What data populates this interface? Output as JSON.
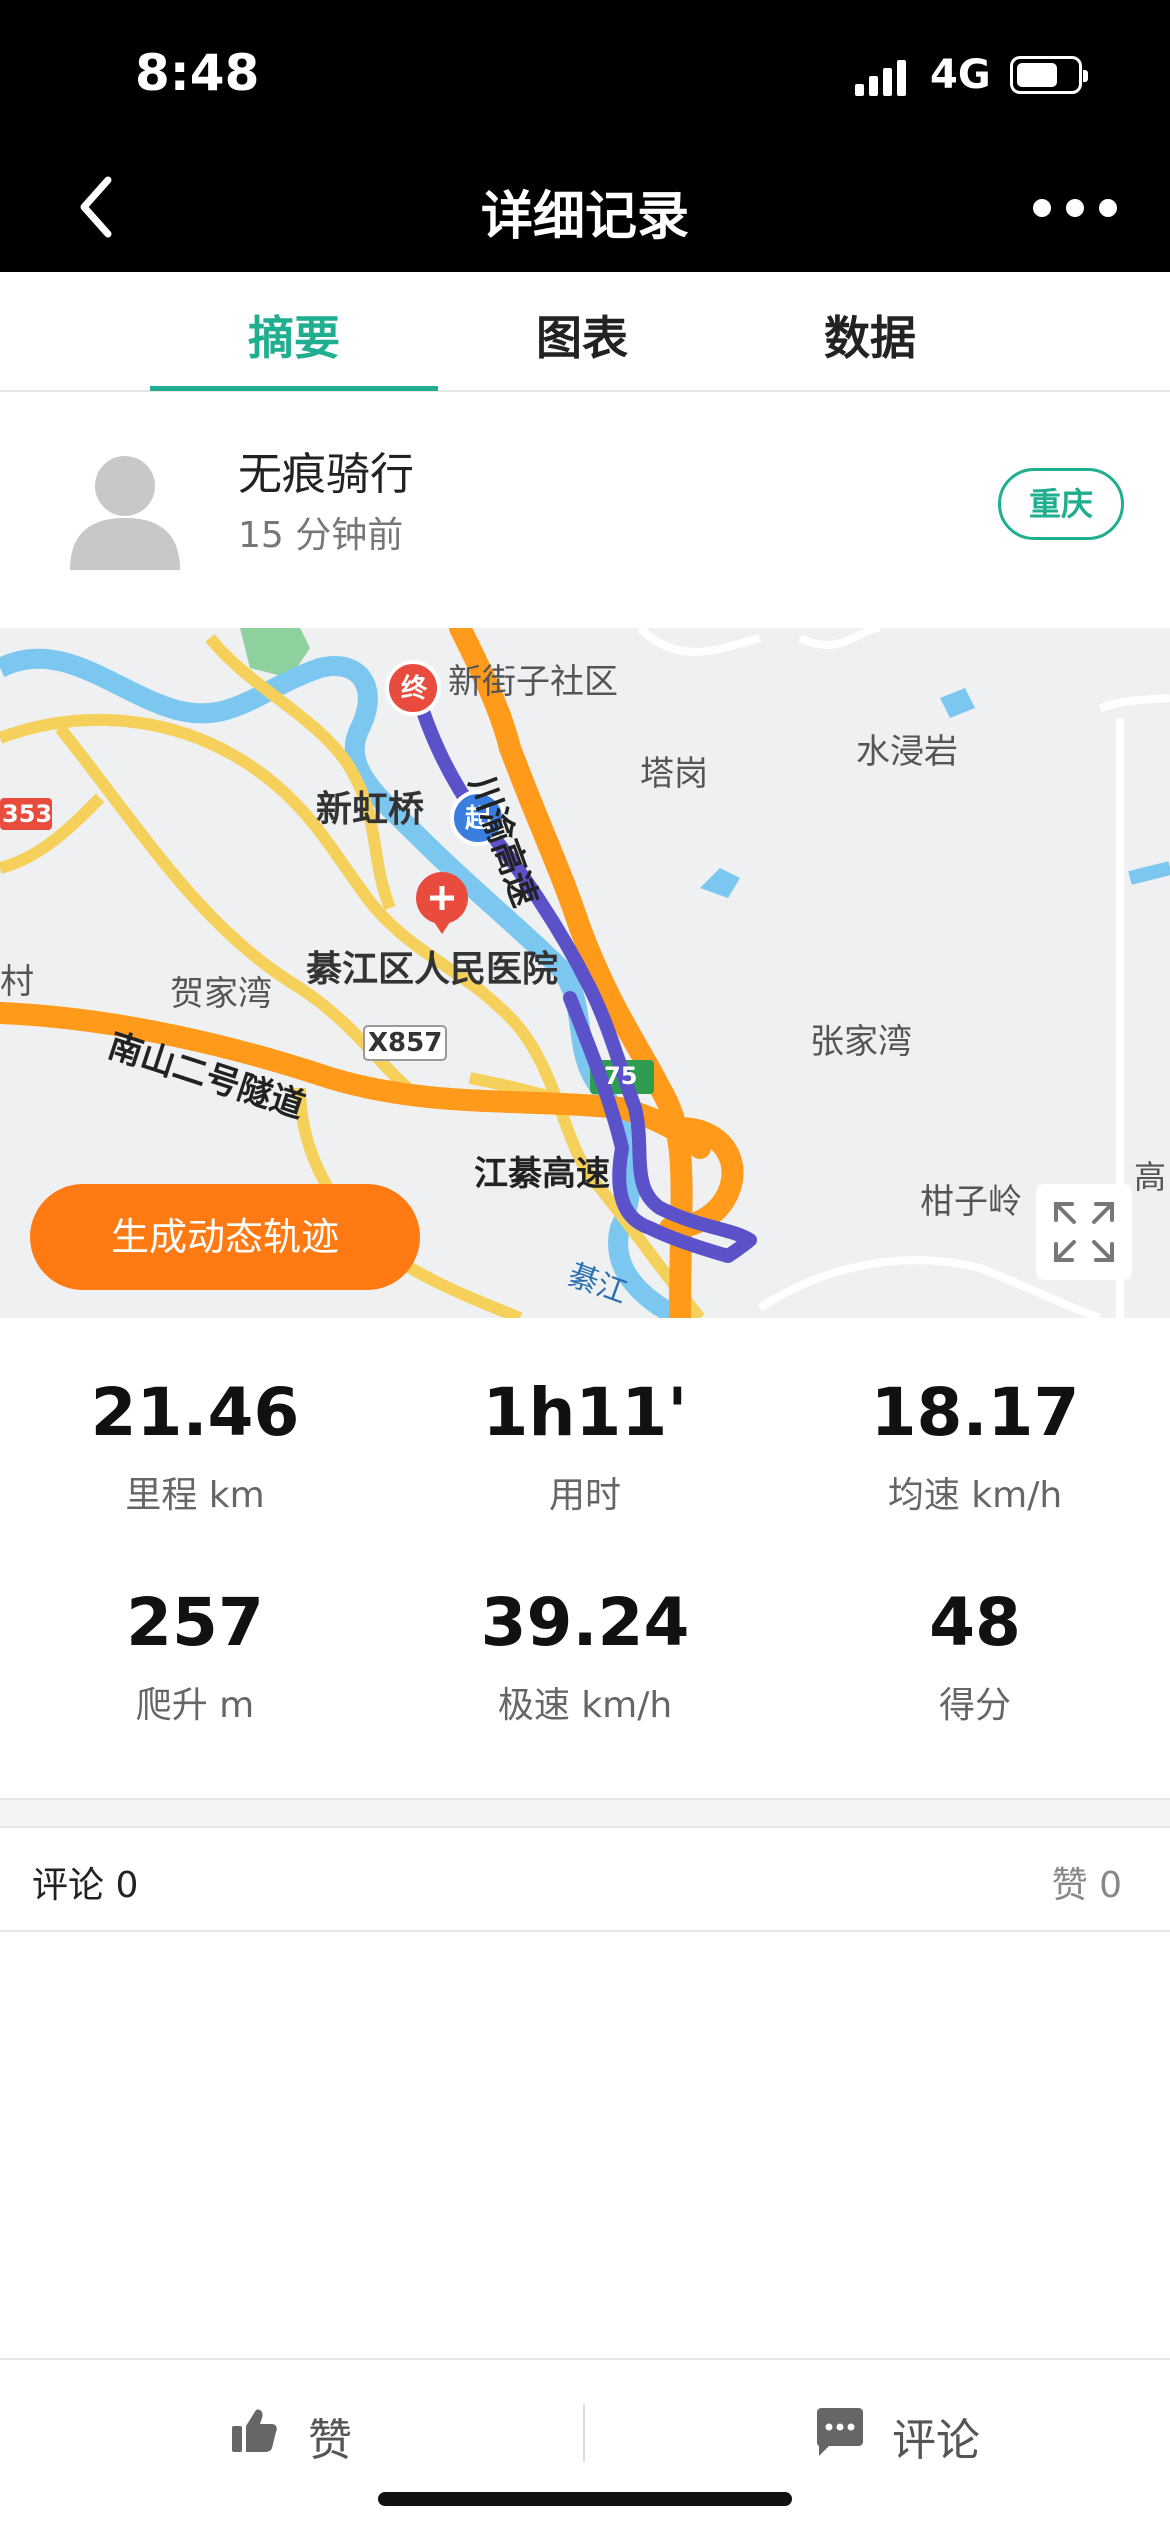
{
  "status_bar": {
    "time": "8:48",
    "network": "4G"
  },
  "nav": {
    "title": "详细记录"
  },
  "tabs": [
    {
      "label": "摘要"
    },
    {
      "label": "图表"
    },
    {
      "label": "数据"
    }
  ],
  "user": {
    "name": "无痕骑行",
    "time_ago": "15 分钟前",
    "city": "重庆"
  },
  "map": {
    "labels": {
      "l1": "新街子社区",
      "l2": "塔岗",
      "l3": "水浸岩",
      "l4": "新虹桥",
      "l5": "綦江区人民医院",
      "l6": "贺家湾",
      "l7": "X857",
      "l8": "南山二号隧道",
      "l9": "江綦高速",
      "l10": "张家湾",
      "l11": "柑子岭",
      "l12": "川渝高速",
      "l13": "綦江",
      "l14": "353",
      "l15": "村",
      "l16": "高",
      "l17": "75"
    },
    "end_marker": "终",
    "start_marker": "起",
    "generate_button": "生成动态轨迹"
  },
  "stats": [
    {
      "value": "21.46",
      "label": "里程 km"
    },
    {
      "value": "1h11'",
      "label": "用时"
    },
    {
      "value": "18.17",
      "label": "均速 km/h"
    },
    {
      "value": "257",
      "label": "爬升 m"
    },
    {
      "value": "39.24",
      "label": "极速 km/h"
    },
    {
      "value": "48",
      "label": "得分"
    }
  ],
  "social": {
    "comments": "评论 0",
    "likes": "赞 0"
  },
  "bottom_bar": {
    "like": "赞",
    "comment": "评论"
  },
  "colors": {
    "accent": "#1fae8f",
    "route": "#5b52c9",
    "orange": "#ff7a12"
  }
}
